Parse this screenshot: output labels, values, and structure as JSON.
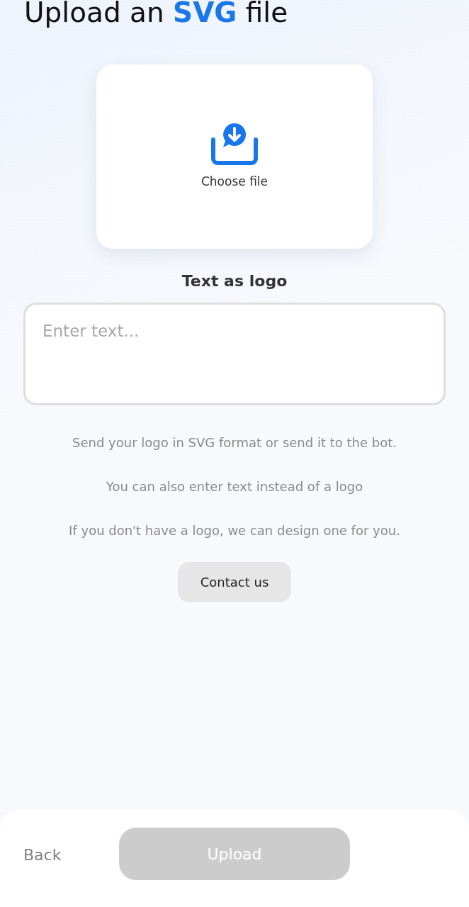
{
  "title": "Upload an **SVG** file",
  "upload_card": {
    "label": "Choose file"
  },
  "text_logo": {
    "label": "Text as logo",
    "placeholder": "Enter text..."
  },
  "hints": [
    "Send your logo in SVG format or send it to the bot.",
    "You can also enter text instead of a logo",
    "If you don't have a logo, we can design one for you."
  ],
  "contact_button": "Contact us",
  "footer": {
    "back": "Back",
    "upload": {
      "label": "Upload",
      "disabled": true
    }
  }
}
